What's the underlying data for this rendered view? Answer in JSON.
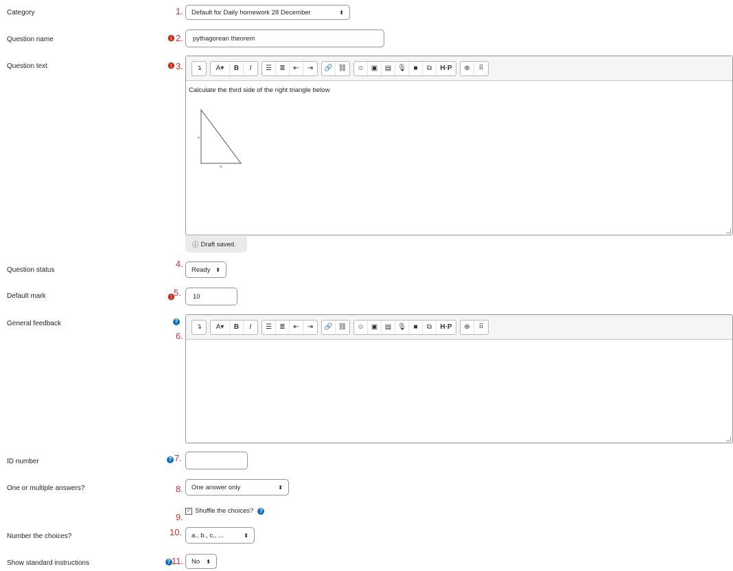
{
  "fields": {
    "category": {
      "label": "Category",
      "number": "1.",
      "value": "Default for Daily homework 28 December"
    },
    "question_name": {
      "label": "Question name",
      "number": "2.",
      "value": "pythagorean theorem"
    },
    "question_text": {
      "label": "Question text",
      "number": "3.",
      "content": "Calculate the third side of the right triangle below",
      "triangle_label_a": "a",
      "triangle_label_b": "a",
      "draft_status": "Draft saved."
    },
    "question_status": {
      "label": "Question status",
      "number": "4.",
      "value": "Ready"
    },
    "default_mark": {
      "label": "Default mark",
      "number": "5.",
      "value": "10"
    },
    "general_feedback": {
      "label": "General feedback",
      "number": "6."
    },
    "id_number": {
      "label": "ID number",
      "number": "7.",
      "value": ""
    },
    "answers": {
      "label": "One or multiple answers?",
      "number": "8.",
      "value": "One answer only"
    },
    "shuffle": {
      "label": "Shuffle the choices?",
      "number": "9.",
      "checked": true
    },
    "number_choices": {
      "label": "Number the choices?",
      "number": "10.",
      "value": "a., b., c., ..."
    },
    "show_instructions": {
      "label": "Show standard instructions",
      "number": "11.",
      "value": "No"
    }
  },
  "icons": {
    "required": "exclamation-icon",
    "help": "question-circle-icon"
  },
  "colors": {
    "number": "#d32f2f",
    "required": "#ca3120",
    "help": "#0f6cbf"
  }
}
